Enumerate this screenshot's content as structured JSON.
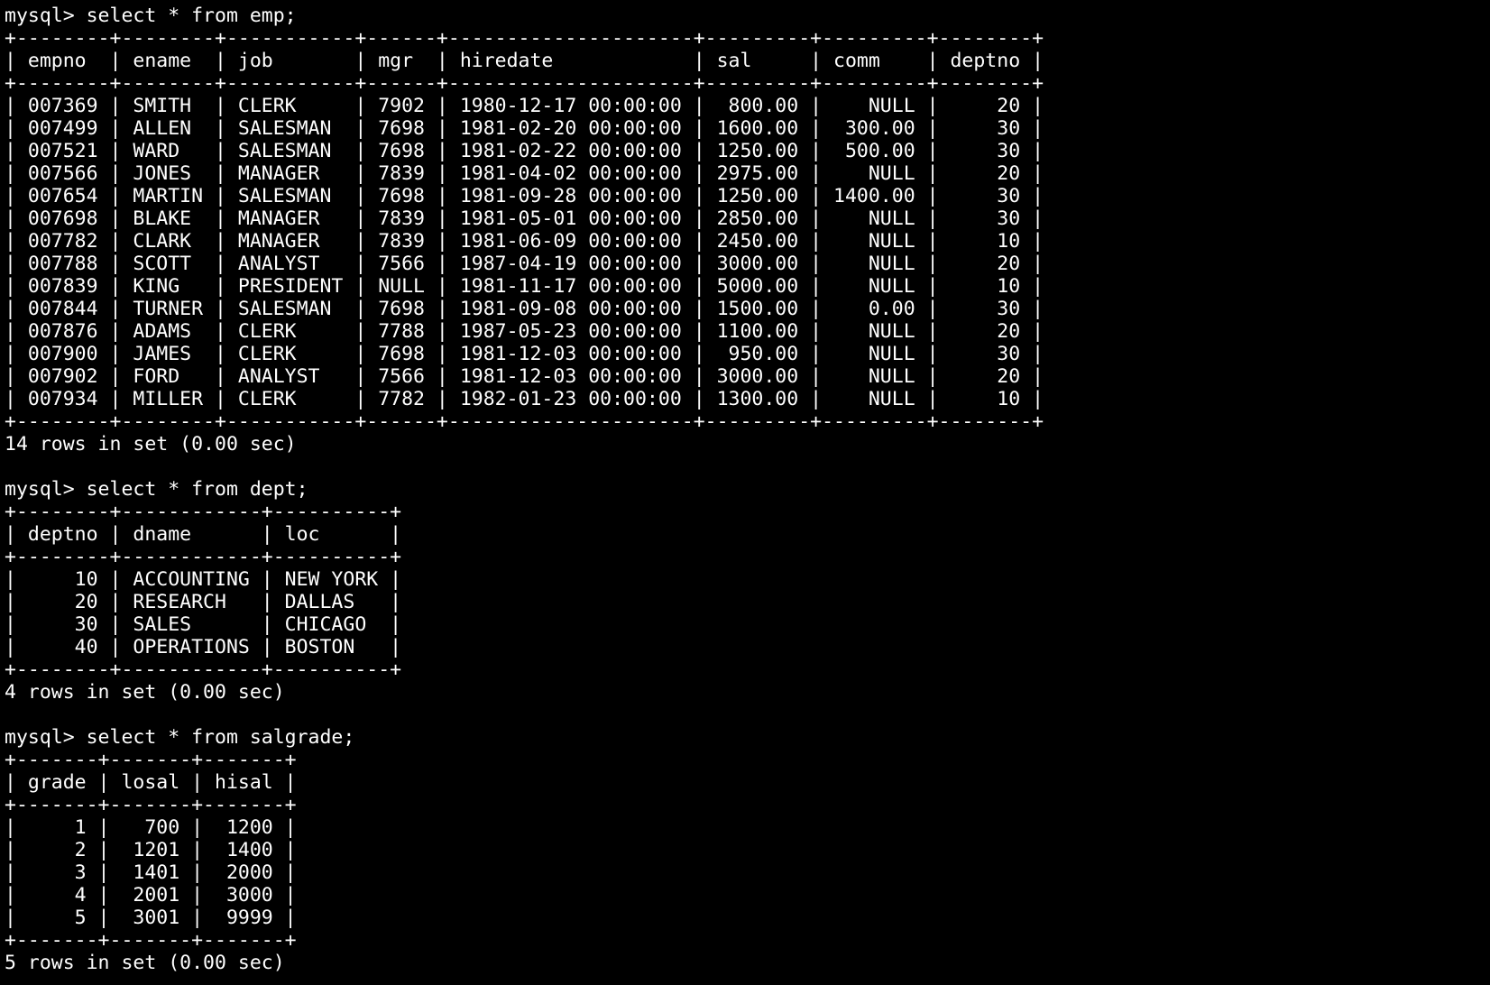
{
  "terminal": {
    "bg_color": "#000000",
    "fg_color": "#ffffff",
    "prompt": "mysql> ",
    "blocks": [
      {
        "command": "select * from emp;",
        "lines": [
          "+--------+--------+-----------+------+---------------------+---------+---------+--------+",
          "| empno  | ename  | job       | mgr  | hiredate            | sal     | comm    | deptno |",
          "+--------+--------+-----------+------+---------------------+---------+---------+--------+",
          "| 007369 | SMITH  | CLERK     | 7902 | 1980-12-17 00:00:00 |  800.00 |    NULL |     20 |",
          "| 007499 | ALLEN  | SALESMAN  | 7698 | 1981-02-20 00:00:00 | 1600.00 |  300.00 |     30 |",
          "| 007521 | WARD   | SALESMAN  | 7698 | 1981-02-22 00:00:00 | 1250.00 |  500.00 |     30 |",
          "| 007566 | JONES  | MANAGER   | 7839 | 1981-04-02 00:00:00 | 2975.00 |    NULL |     20 |",
          "| 007654 | MARTIN | SALESMAN  | 7698 | 1981-09-28 00:00:00 | 1250.00 | 1400.00 |     30 |",
          "| 007698 | BLAKE  | MANAGER   | 7839 | 1981-05-01 00:00:00 | 2850.00 |    NULL |     30 |",
          "| 007782 | CLARK  | MANAGER   | 7839 | 1981-06-09 00:00:00 | 2450.00 |    NULL |     10 |",
          "| 007788 | SCOTT  | ANALYST   | 7566 | 1987-04-19 00:00:00 | 3000.00 |    NULL |     20 |",
          "| 007839 | KING   | PRESIDENT | NULL | 1981-11-17 00:00:00 | 5000.00 |    NULL |     10 |",
          "| 007844 | TURNER | SALESMAN  | 7698 | 1981-09-08 00:00:00 | 1500.00 |    0.00 |     30 |",
          "| 007876 | ADAMS  | CLERK     | 7788 | 1987-05-23 00:00:00 | 1100.00 |    NULL |     20 |",
          "| 007900 | JAMES  | CLERK     | 7698 | 1981-12-03 00:00:00 |  950.00 |    NULL |     30 |",
          "| 007902 | FORD   | ANALYST   | 7566 | 1981-12-03 00:00:00 | 3000.00 |    NULL |     20 |",
          "| 007934 | MILLER | CLERK     | 7782 | 1982-01-23 00:00:00 | 1300.00 |    NULL |     10 |",
          "+--------+--------+-----------+------+---------------------+---------+---------+--------+"
        ],
        "result": "14 rows in set (0.00 sec)"
      },
      {
        "command": "select * from dept;",
        "lines": [
          "+--------+------------+----------+",
          "| deptno | dname      | loc      |",
          "+--------+------------+----------+",
          "|     10 | ACCOUNTING | NEW YORK |",
          "|     20 | RESEARCH   | DALLAS   |",
          "|     30 | SALES      | CHICAGO  |",
          "|     40 | OPERATIONS | BOSTON   |",
          "+--------+------------+----------+"
        ],
        "result": "4 rows in set (0.00 sec)"
      },
      {
        "command": "select * from salgrade;",
        "lines": [
          "+-------+-------+-------+",
          "| grade | losal | hisal |",
          "+-------+-------+-------+",
          "|     1 |   700 |  1200 |",
          "|     2 |  1201 |  1400 |",
          "|     3 |  1401 |  2000 |",
          "|     4 |  2001 |  3000 |",
          "|     5 |  3001 |  9999 |",
          "+-------+-------+-------+"
        ],
        "result": "5 rows in set (0.00 sec)"
      }
    ]
  }
}
